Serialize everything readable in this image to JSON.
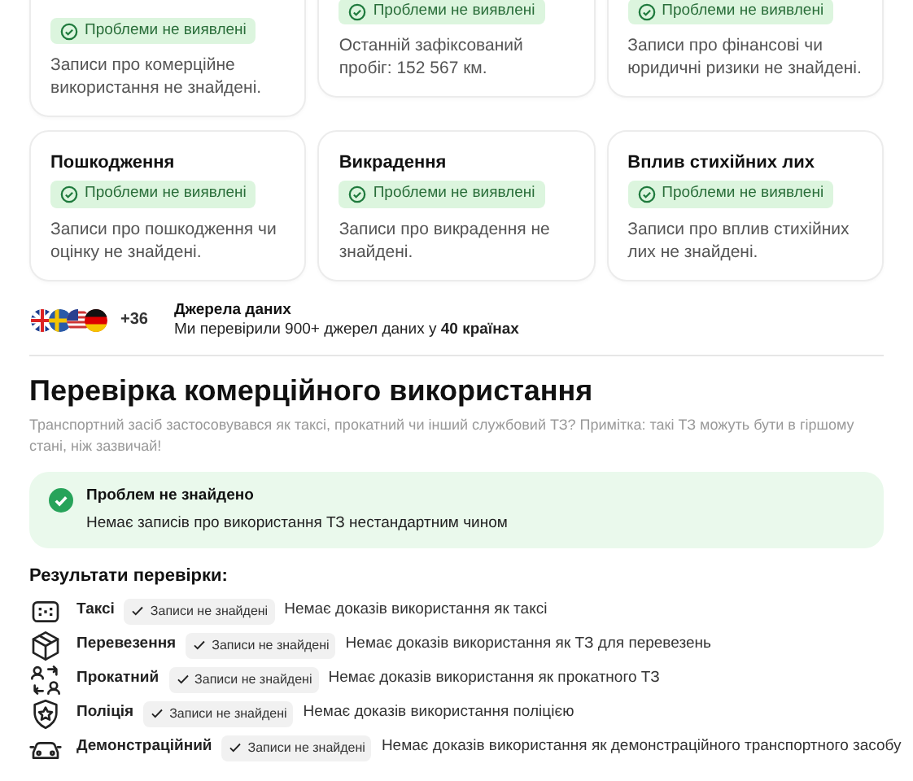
{
  "cards": [
    {
      "badge": "Проблеми не виявлені",
      "text": "Записи про комерційне використання не знайдені."
    },
    {
      "badge": "Проблеми не виявлені",
      "text": "Останній зафіксований пробіг: 152 567 км."
    },
    {
      "badge": "Проблеми не виявлені",
      "text": "Записи про фінансові чи юридичні ризики не знайдені."
    },
    {
      "title": "Пошкодження",
      "badge": "Проблеми не виявлені",
      "text": "Записи про пошкодження чи оцінку не знайдені."
    },
    {
      "title": "Викрадення",
      "badge": "Проблеми не виявлені",
      "text": "Записи про викрадення не знайдені."
    },
    {
      "title": "Вплив стихійних лих",
      "badge": "Проблеми не виявлені",
      "text": "Записи про вплив стихійних лих не знайдені."
    }
  ],
  "sources": {
    "more": "+36",
    "title": "Джерела даних",
    "text": "Ми перевірили 900+ джерел даних у **40 країнах**"
  },
  "section": {
    "title": "Перевірка комерційного використання",
    "subtitle": "Транспортний засіб застосовувався як таксі, прокатний чи інший службовий ТЗ? Примітка: такі ТЗ можуть бути в гіршому стані, ніж зазвичай!",
    "alert": {
      "title": "Проблем не знайдено",
      "text": "Немає записів про використання ТЗ нестандартним чином"
    },
    "results_title": "Результати перевірки:",
    "results": [
      {
        "kind": "taxi",
        "label": "Таксі",
        "badge": "Записи не знайдені",
        "text": "Немає доказів використання як таксі"
      },
      {
        "kind": "box",
        "label": "Перевезення",
        "badge": "Записи не знайдені",
        "text": "Немає доказів використання як ТЗ для перевезень"
      },
      {
        "kind": "rental",
        "label": "Прокатний",
        "badge": "Записи не знайдені",
        "text": "Немає доказів використання як прокатного ТЗ"
      },
      {
        "kind": "police",
        "label": "Поліція",
        "badge": "Записи не знайдені",
        "text": "Немає доказів використання поліцією"
      },
      {
        "kind": "car",
        "label": "Демонстраційний",
        "badge": "Записи не знайдені",
        "text": "Немає доказів використання як демонстраційного транспортного засобу"
      }
    ]
  }
}
